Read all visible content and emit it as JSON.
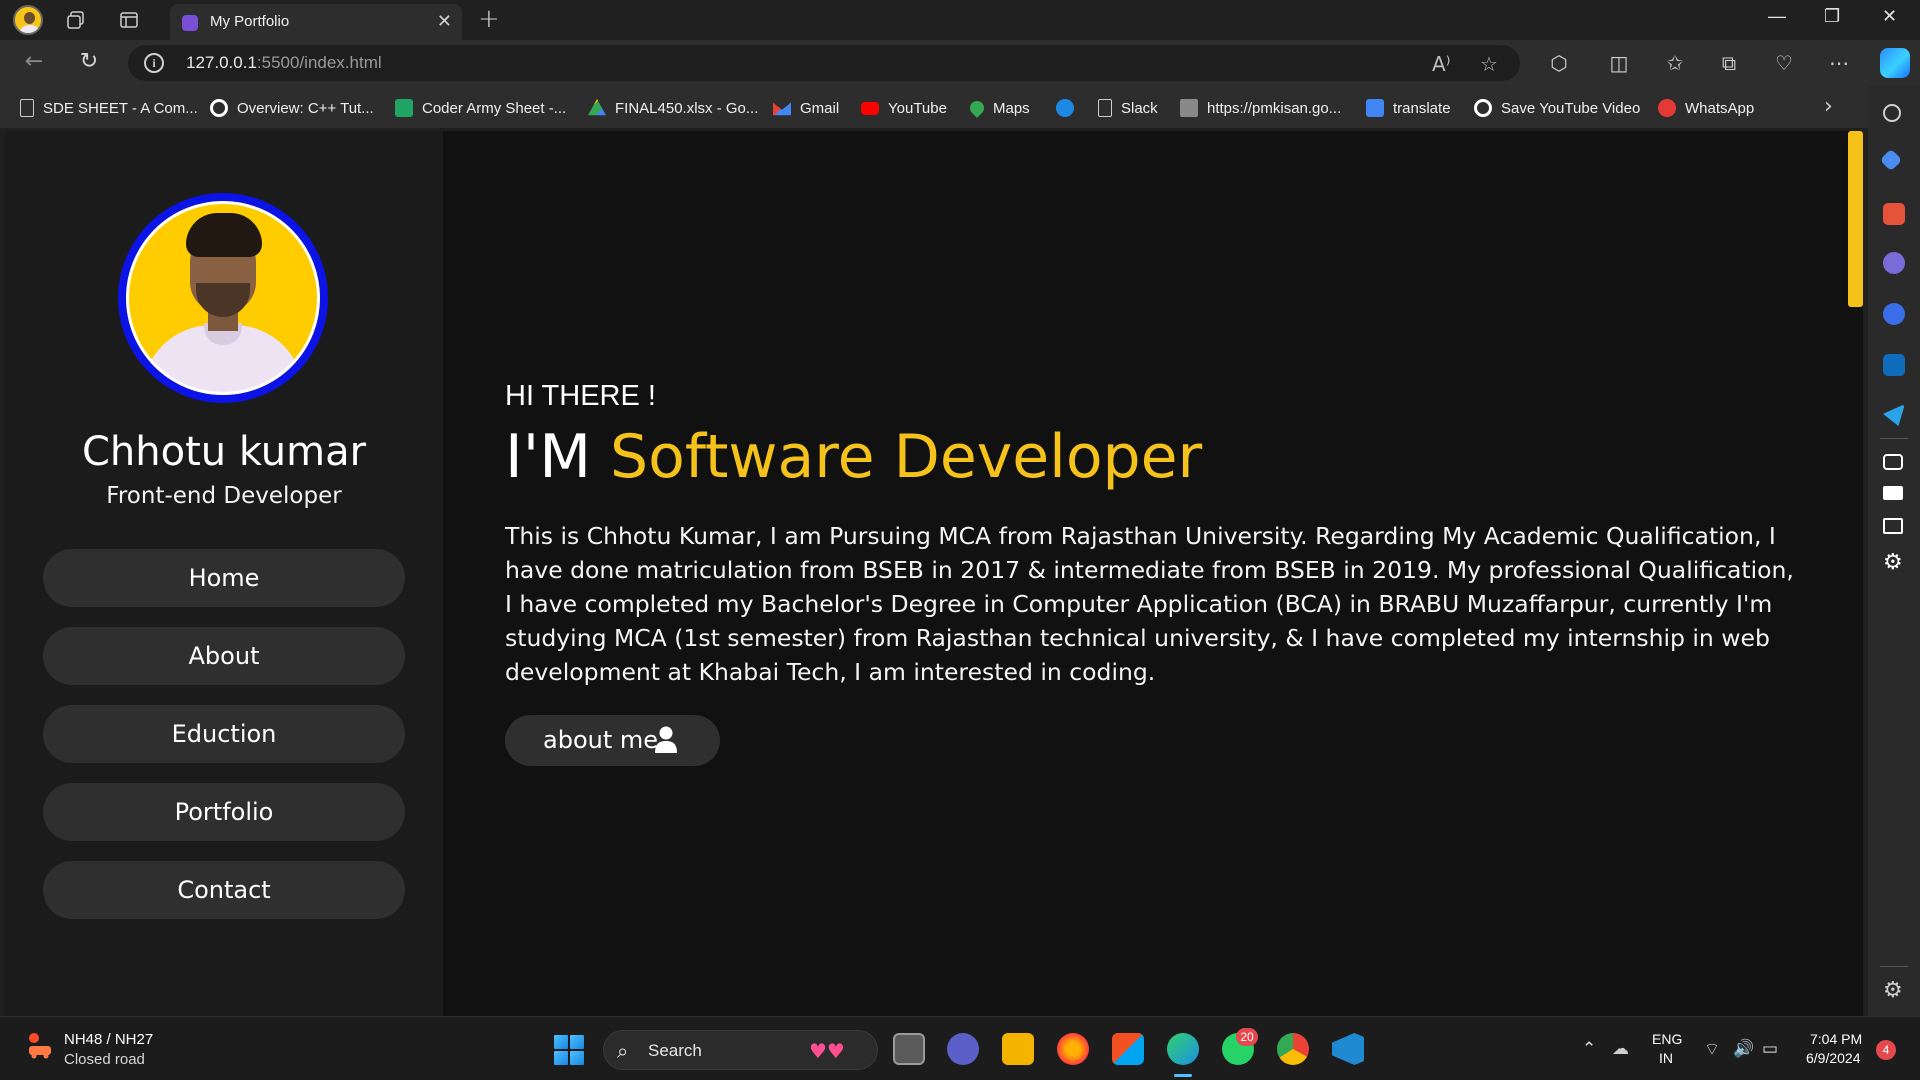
{
  "browser": {
    "tab_title": "My Portfolio",
    "url_host": "127.0.0.1",
    "url_rest": ":5500/index.html"
  },
  "bookmarks": [
    {
      "label": "SDE SHEET - A Com...",
      "icon": "document-icon",
      "color": "#cccccc"
    },
    {
      "label": "Overview: C++ Tut...",
      "icon": "google-icon",
      "color": "#ffffff"
    },
    {
      "label": "Coder Army Sheet -...",
      "icon": "sheets-icon",
      "color": "#1fa463"
    },
    {
      "label": "FINAL450.xlsx - Go...",
      "icon": "drive-icon",
      "color": "#fbbc04"
    },
    {
      "label": "Gmail",
      "icon": "gmail-icon",
      "color": "#ea4335"
    },
    {
      "label": "YouTube",
      "icon": "youtube-icon",
      "color": "#ff0000"
    },
    {
      "label": "Maps",
      "icon": "maps-icon",
      "color": "#34a853"
    },
    {
      "label": "",
      "icon": "c-logo-icon",
      "color": "#1e88e5"
    },
    {
      "label": "Slack",
      "icon": "document-icon",
      "color": "#cccccc"
    },
    {
      "label": "https://pmkisan.go...",
      "icon": "pmkisan-icon",
      "color": "#888888"
    },
    {
      "label": "translate",
      "icon": "translate-icon",
      "color": "#4285f4"
    },
    {
      "label": "Save YouTube Video",
      "icon": "google-icon",
      "color": "#ffffff"
    },
    {
      "label": "WhatsApp",
      "icon": "whatsapp-warning-icon",
      "color": "#e53935"
    }
  ],
  "profile": {
    "name": "Chhotu kumar",
    "role": "Front-end Developer"
  },
  "menu": [
    {
      "label": "Home"
    },
    {
      "label": "About"
    },
    {
      "label": "Eduction"
    },
    {
      "label": "Portfolio"
    },
    {
      "label": "Contact"
    }
  ],
  "hero": {
    "greeting": "HI THERE !",
    "prefix": "I'M",
    "highlight": "Software Developer",
    "bio": "This is Chhotu Kumar, I am Pursuing MCA from Rajasthan University. Regarding My Academic Qualification, I have done matriculation from BSEB in 2017 & intermediate from BSEB in 2019. My professional Qualification, I have completed my Bachelor's Degree in Computer Application (BCA) in BRABU Muzaffarpur, currently I'm studying MCA (1st semester) from Rajasthan technical university, & I have completed my internship in web development at Khabai Tech, I am interested in coding.",
    "button_label": "about me",
    "accent_color": "#f5c21b"
  },
  "taskbar": {
    "weather_line1": "NH48 / NH27",
    "weather_line2": "Closed road",
    "search_label": "Search",
    "whatsapp_badge": "20",
    "lang_line1": "ENG",
    "lang_line2": "IN",
    "time": "7:04 PM",
    "date": "6/9/2024",
    "notifications": "4"
  }
}
